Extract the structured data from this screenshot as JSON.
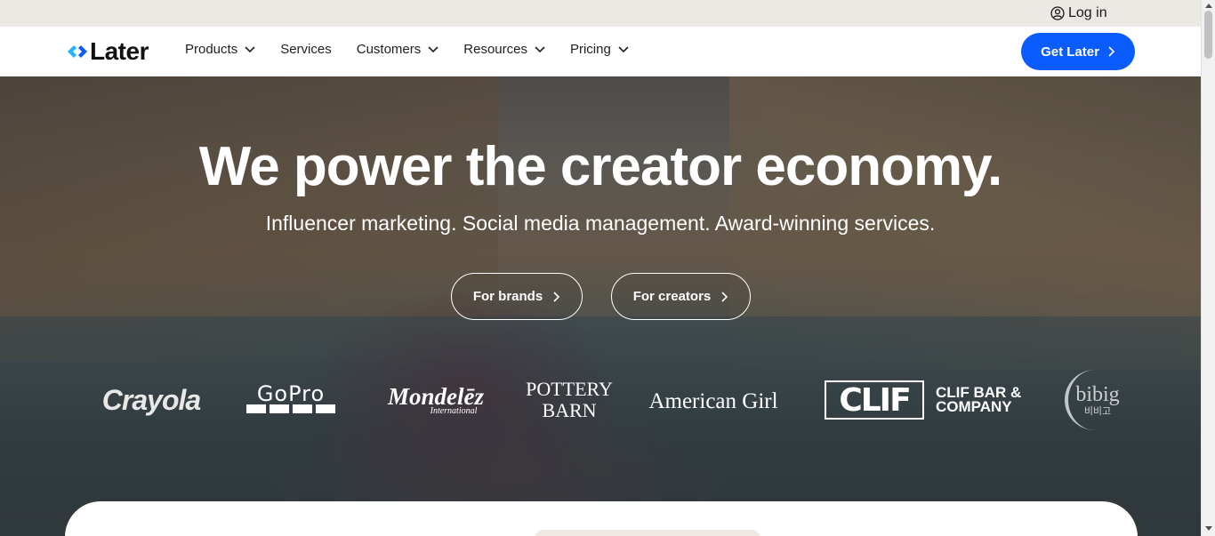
{
  "utility_bar": {
    "login_label": "Log in",
    "login_icon": "user-circle-icon"
  },
  "nav": {
    "logo_text": "Later",
    "logo_icon": "later-logo-icon",
    "items": [
      {
        "label": "Products",
        "has_dropdown": true
      },
      {
        "label": "Services",
        "has_dropdown": false
      },
      {
        "label": "Customers",
        "has_dropdown": true
      },
      {
        "label": "Resources",
        "has_dropdown": true
      },
      {
        "label": "Pricing",
        "has_dropdown": true
      }
    ],
    "cta_label": "Get Later",
    "cta_color": "#0b5cff"
  },
  "hero": {
    "headline": "We power the creator economy.",
    "subheadline": "Influencer marketing. Social media management. Award-winning services.",
    "buttons": [
      {
        "label": "For brands"
      },
      {
        "label": "For creators"
      }
    ]
  },
  "logos": {
    "crayola": "Crayola",
    "gopro": "GoPro",
    "mondelez": "Mondelēz",
    "mondelez_sub": "International",
    "pottery_line1": "POTTERY",
    "pottery_line2": "BARN",
    "american_girl": "American Girl",
    "clif": "CLIF",
    "clif_company_line1": "CLIF BAR &",
    "clif_company_line2": "COMPANY",
    "bibigo": "bibig",
    "bibigo_sub": "비비고"
  }
}
